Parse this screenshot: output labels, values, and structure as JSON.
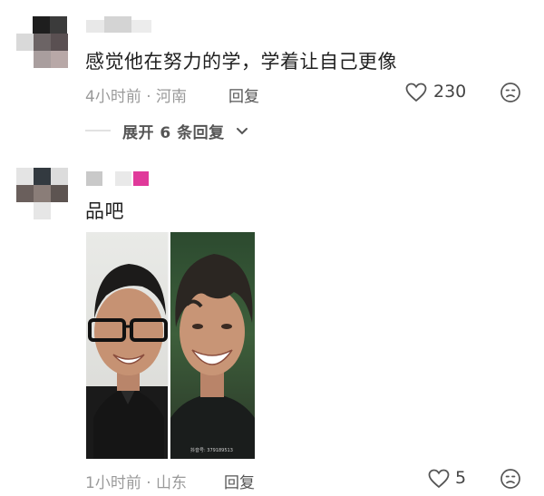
{
  "comments": [
    {
      "text": "感觉他在努力的学，学着让自己更像",
      "meta": "4小时前 · 河南",
      "reply_label": "回复",
      "likes": "230",
      "expand_label": "展开 6 条回复"
    },
    {
      "text": "品吧",
      "meta": "1小时前 · 山东",
      "reply_label": "回复",
      "likes": "5",
      "photo_watermark": "抖音号: 379189513"
    }
  ],
  "icons": {
    "like": "heart-outline-icon",
    "dislike": "frown-face-icon",
    "expand": "chevron-down-icon"
  },
  "colors": {
    "accent_badge": "#e0399a",
    "meta_gray": "#9a9a9a"
  }
}
